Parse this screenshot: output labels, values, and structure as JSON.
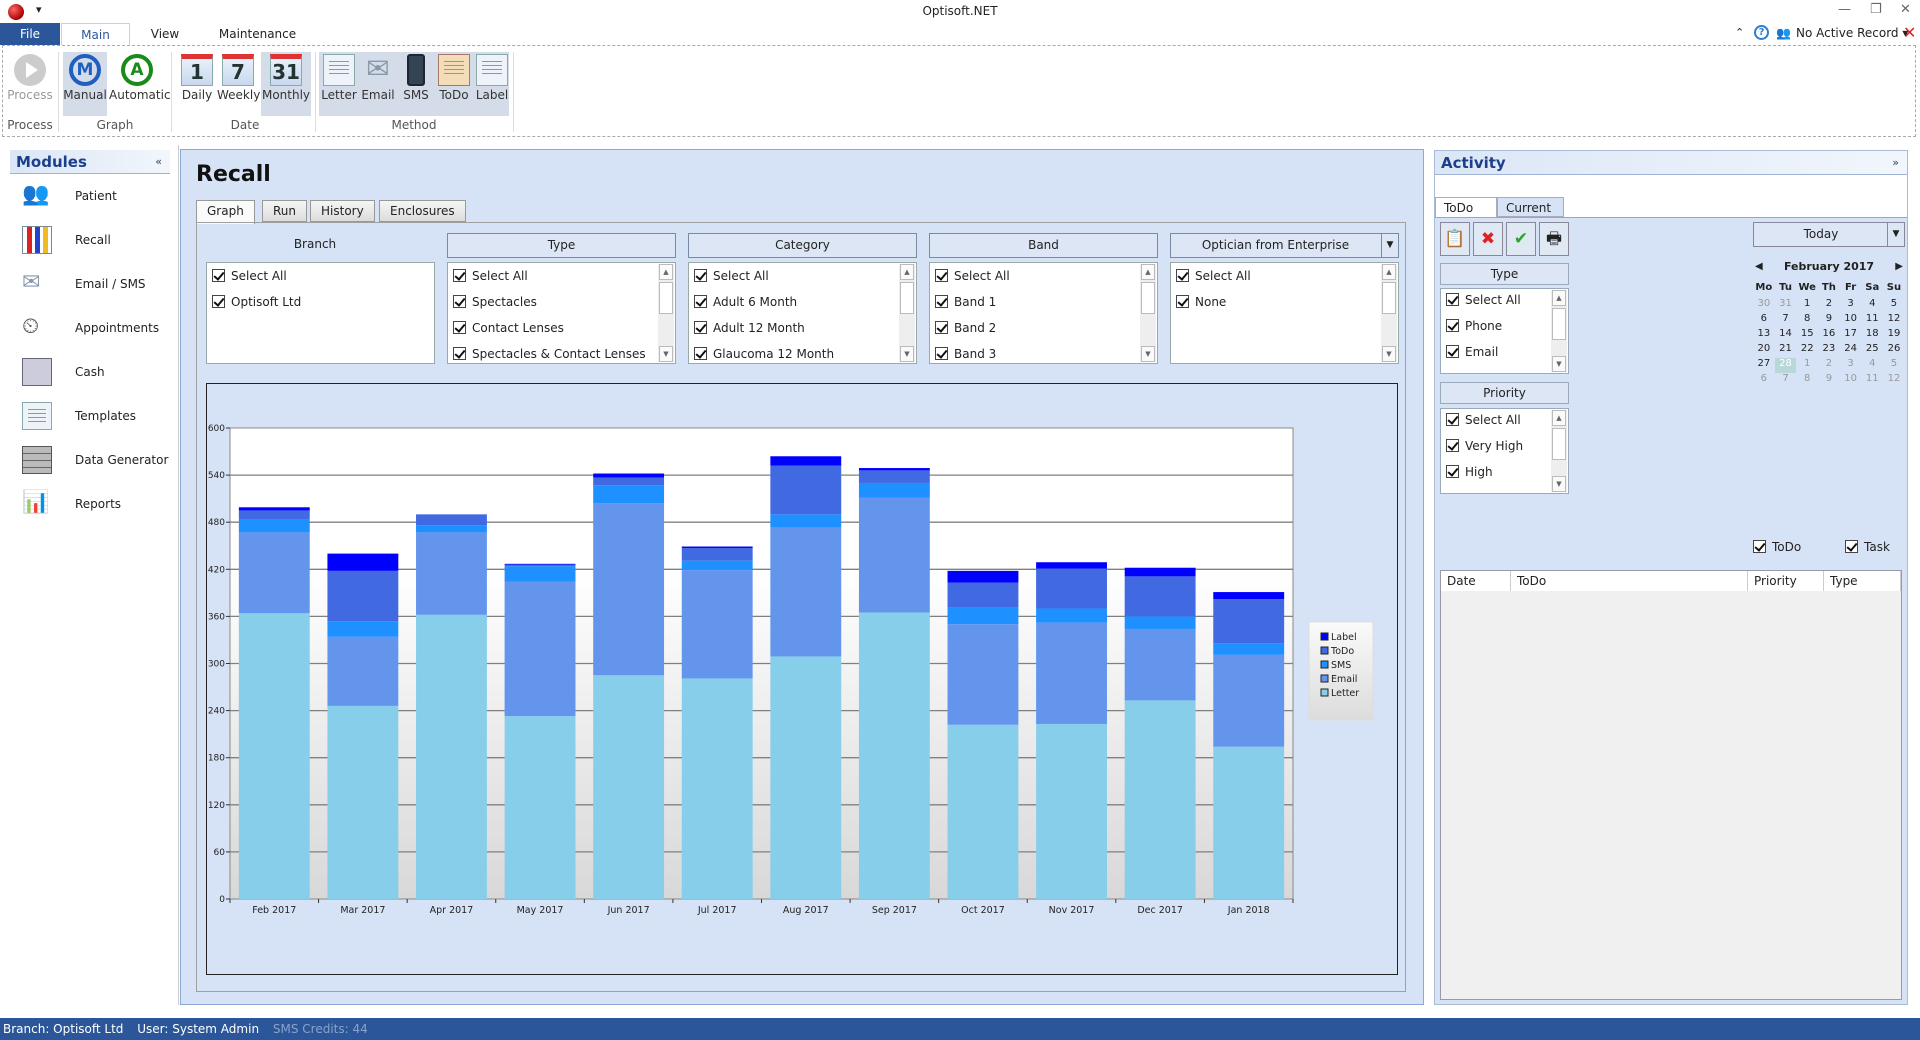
{
  "app": {
    "title": "Optisoft.NET",
    "record": "No Active Record"
  },
  "ribbon_tabs": [
    "File",
    "Main",
    "View",
    "Maintenance"
  ],
  "ribbon": {
    "process": {
      "label": "Process",
      "group": "Process"
    },
    "graph": {
      "group": "Graph",
      "manual": "Manual",
      "automatic": "Automatic"
    },
    "date": {
      "group": "Date",
      "daily": "Daily",
      "weekly": "Weekly",
      "monthly": "Monthly",
      "daily_num": "1",
      "weekly_num": "7",
      "monthly_num": "31"
    },
    "method": {
      "group": "Method",
      "letter": "Letter",
      "email": "Email",
      "sms": "SMS",
      "todo": "ToDo",
      "label": "Label"
    }
  },
  "modules": {
    "title": "Modules",
    "items": [
      "Patient",
      "Recall",
      "Email / SMS",
      "Appointments",
      "Cash",
      "Templates",
      "Data Generator",
      "Reports"
    ]
  },
  "recall": {
    "title": "Recall",
    "tabs": [
      "Graph",
      "Run",
      "History",
      "Enclosures"
    ],
    "filters": {
      "branch": {
        "title": "Branch",
        "items": [
          "Select All",
          "Optisoft Ltd"
        ]
      },
      "type": {
        "title": "Type",
        "items": [
          "Select All",
          "Spectacles",
          "Contact Lenses",
          "Spectacles & Contact Lenses"
        ]
      },
      "category": {
        "title": "Category",
        "items": [
          "Select All",
          "Adult 6 Month",
          "Adult 12 Month",
          "Glaucoma 12 Month"
        ]
      },
      "band": {
        "title": "Band",
        "items": [
          "Select All",
          "Band 1",
          "Band 2",
          "Band 3"
        ]
      },
      "optician": {
        "title": "Optician from Enterprise",
        "items": [
          "Select All",
          "None"
        ]
      }
    }
  },
  "chart_data": {
    "type": "bar",
    "stacked": true,
    "categories": [
      "Feb 2017",
      "Mar 2017",
      "Apr 2017",
      "May 2017",
      "Jun 2017",
      "Jul 2017",
      "Aug 2017",
      "Sep 2017",
      "Oct 2017",
      "Nov 2017",
      "Dec 2017",
      "Jan 2018"
    ],
    "series": [
      {
        "name": "Letter",
        "color": "#87CEEB",
        "values": [
          364,
          246,
          362,
          233,
          285,
          281,
          309,
          365,
          222,
          223,
          253,
          194
        ]
      },
      {
        "name": "Email",
        "color": "#6495ED",
        "values": [
          103,
          88,
          105,
          171,
          219,
          138,
          164,
          146,
          128,
          129,
          91,
          117
        ]
      },
      {
        "name": "SMS",
        "color": "#1E90FF",
        "values": [
          16,
          20,
          9,
          20,
          23,
          12,
          17,
          19,
          21,
          18,
          16,
          15
        ]
      },
      {
        "name": "ToDo",
        "color": "#4169E1",
        "values": [
          12,
          64,
          14,
          2,
          10,
          16,
          62,
          16,
          32,
          51,
          51,
          56
        ]
      },
      {
        "name": "Label",
        "color": "#0000FF",
        "values": [
          4,
          22,
          0,
          1,
          5,
          2,
          12,
          3,
          15,
          8,
          11,
          9
        ]
      }
    ],
    "legend_order": [
      "Label",
      "ToDo",
      "SMS",
      "Email",
      "Letter"
    ],
    "yticks": [
      "0",
      "60",
      "120",
      "180",
      "240",
      "300",
      "360",
      "420",
      "480",
      "540",
      "600"
    ],
    "ylim": [
      0,
      600
    ],
    "grid": true,
    "legend": "right"
  },
  "activity": {
    "title": "Activity",
    "tabs": [
      "ToDo",
      "Current"
    ],
    "type": {
      "title": "Type",
      "items": [
        "Select All",
        "Phone",
        "Email"
      ]
    },
    "priority": {
      "title": "Priority",
      "items": [
        "Select All",
        "Very High",
        "High"
      ]
    },
    "today": "Today",
    "calendar": {
      "month": "February 2017",
      "days": [
        "Mo",
        "Tu",
        "We",
        "Th",
        "Fr",
        "Sa",
        "Su"
      ],
      "weeks": [
        [
          "30",
          "31",
          "1",
          "2",
          "3",
          "4",
          "5"
        ],
        [
          "6",
          "7",
          "8",
          "9",
          "10",
          "11",
          "12"
        ],
        [
          "13",
          "14",
          "15",
          "16",
          "17",
          "18",
          "19"
        ],
        [
          "20",
          "21",
          "22",
          "23",
          "24",
          "25",
          "26"
        ],
        [
          "27",
          "28",
          "1",
          "2",
          "3",
          "4",
          "5"
        ],
        [
          "6",
          "7",
          "8",
          "9",
          "10",
          "11",
          "12"
        ]
      ],
      "selected": "28"
    },
    "show_todo": "ToDo",
    "show_task": "Task",
    "columns": [
      "Date",
      "ToDo",
      "Priority",
      "Type"
    ]
  },
  "status": {
    "branch": "Branch: Optisoft Ltd",
    "user": "User: System Admin",
    "sms": "SMS Credits: 44"
  }
}
